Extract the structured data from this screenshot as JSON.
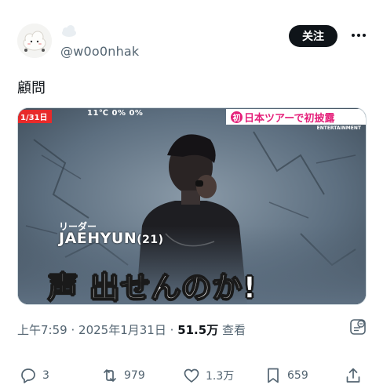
{
  "author": {
    "handle": "@w0o0nhak"
  },
  "follow_button": {
    "label": "关注"
  },
  "post": {
    "text": "顧問"
  },
  "media": {
    "date_badge": "1/31日",
    "weather": "11℃  0%  0%",
    "ticker_first": "初",
    "ticker_text": "日本ツアーで初披露",
    "ticker_sub": "ENTERTAINMENT",
    "role": "リーダー",
    "name": "JAEHYUN",
    "age": "(21)",
    "caption": "声 出せんのか!"
  },
  "meta": {
    "time": "上午7:59",
    "date": "2025年1月31日",
    "views": "51.5万",
    "views_label": "查看",
    "separator": "·"
  },
  "actions": {
    "replies": "3",
    "reposts": "979",
    "likes": "1.3万",
    "bookmarks": "659"
  },
  "colors": {
    "accent": "#0f1419",
    "muted": "#536471",
    "tv_red": "#e82a2a",
    "tv_pink": "#e5207a"
  }
}
